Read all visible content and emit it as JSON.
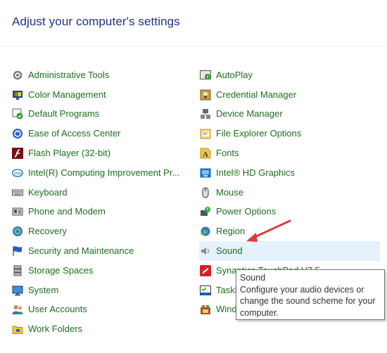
{
  "header": {
    "title": "Adjust your computer's settings"
  },
  "left_items": [
    {
      "label": "Administrative Tools",
      "icon": "admin-tools-icon"
    },
    {
      "label": "Color Management",
      "icon": "color-management-icon"
    },
    {
      "label": "Default Programs",
      "icon": "default-programs-icon"
    },
    {
      "label": "Ease of Access Center",
      "icon": "ease-of-access-icon"
    },
    {
      "label": "Flash Player (32-bit)",
      "icon": "flash-player-icon"
    },
    {
      "label": "Intel(R) Computing Improvement Pr...",
      "icon": "intel-icon"
    },
    {
      "label": "Keyboard",
      "icon": "keyboard-icon"
    },
    {
      "label": "Phone and Modem",
      "icon": "phone-modem-icon"
    },
    {
      "label": "Recovery",
      "icon": "recovery-icon"
    },
    {
      "label": "Security and Maintenance",
      "icon": "security-flag-icon"
    },
    {
      "label": "Storage Spaces",
      "icon": "storage-spaces-icon"
    },
    {
      "label": "System",
      "icon": "system-icon"
    },
    {
      "label": "User Accounts",
      "icon": "user-accounts-icon"
    },
    {
      "label": "Work Folders",
      "icon": "work-folders-icon"
    }
  ],
  "right_items": [
    {
      "label": "AutoPlay",
      "icon": "autoplay-icon"
    },
    {
      "label": "Credential Manager",
      "icon": "credential-manager-icon"
    },
    {
      "label": "Device Manager",
      "icon": "device-manager-icon"
    },
    {
      "label": "File Explorer Options",
      "icon": "file-explorer-options-icon"
    },
    {
      "label": "Fonts",
      "icon": "fonts-icon"
    },
    {
      "label": "Intel® HD Graphics",
      "icon": "intel-graphics-icon"
    },
    {
      "label": "Mouse",
      "icon": "mouse-icon"
    },
    {
      "label": "Power Options",
      "icon": "power-options-icon"
    },
    {
      "label": "Region",
      "icon": "region-icon"
    },
    {
      "label": "Sound",
      "icon": "sound-icon"
    },
    {
      "label": "Synaptics TouchPad V7.5",
      "icon": "synaptics-icon"
    },
    {
      "label": "Taskbar",
      "icon": "taskbar-icon"
    },
    {
      "label": "Windows",
      "icon": "windows-icon"
    }
  ],
  "tooltip": {
    "title": "Sound",
    "description": "Configure your audio devices or change the sound scheme for your computer."
  },
  "colors": {
    "title": "#1e3287",
    "link": "#1c6e1c",
    "hover": "#e5f1fb",
    "arrow": "#e03a3a"
  }
}
